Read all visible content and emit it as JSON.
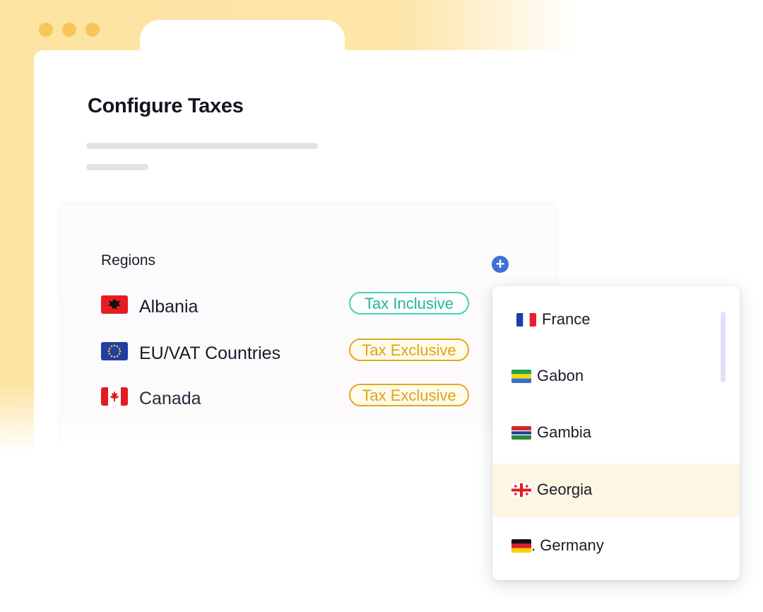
{
  "page": {
    "title": "Configure Taxes"
  },
  "regions": {
    "label": "Regions",
    "items": [
      {
        "name": "Albania",
        "tax": "Tax Inclusive",
        "flag": "albania-flag"
      },
      {
        "name": "EU/VAT Countries",
        "tax": "Tax Exclusive",
        "flag": "eu-flag"
      },
      {
        "name": "Canada",
        "tax": "Tax Exclusive",
        "flag": "canada-flag"
      }
    ]
  },
  "dropdown": {
    "options": [
      {
        "label": "France",
        "flag": "france-flag"
      },
      {
        "label": "Gabon",
        "flag": "gabon-flag"
      },
      {
        "label": "Gambia",
        "flag": "gambia-flag"
      },
      {
        "label": "Georgia",
        "flag": "georgia-flag",
        "selected": true
      },
      {
        "label": ". Germany",
        "flag": "germany-flag"
      }
    ]
  },
  "colors": {
    "backdrop": "#fde3a0",
    "window_dots": "#f7c65a",
    "add_button": "#3f6fd8",
    "badge_inclusive": "#44d1b1",
    "badge_exclusive": "#e3a81f",
    "selected_option": "#fdf6e3"
  }
}
